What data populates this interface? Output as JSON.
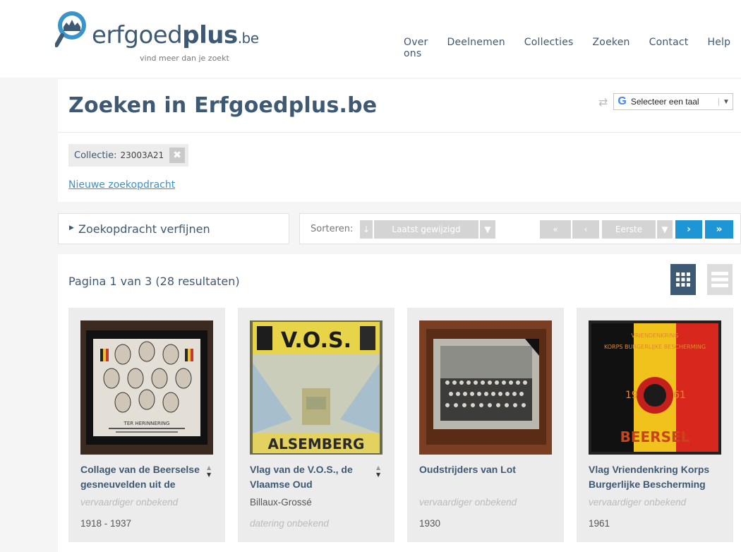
{
  "header": {
    "logo_name": "erfgoed",
    "logo_bold": "plus",
    "logo_tld": ".be",
    "tagline": "vind meer dan je zoekt",
    "nav": [
      "Over ons",
      "Deelnemen",
      "Collecties",
      "Zoeken",
      "Contact",
      "Help"
    ]
  },
  "page_title": "Zoeken in Erfgoedplus.be",
  "translate": {
    "label": "Selecteer een taal",
    "icon": "google-icon"
  },
  "filter": {
    "label": "Collectie:",
    "value": "23003A21"
  },
  "new_search": "Nieuwe zoekopdracht",
  "refine": "Zoekopdracht verfijnen",
  "sort": {
    "label": "Sorteren:",
    "selected": "Laatst gewijzigd"
  },
  "pager": {
    "first": "«",
    "prev": "‹",
    "position": "Eerste",
    "next": "›",
    "last": "»"
  },
  "results_summary": "Pagina 1 van 3 (28 resultaten)",
  "cards": [
    {
      "title": "Collage van de Beerselse gesneuvelden uit de",
      "maker": "vervaardiger onbekend",
      "date": "1918 - 1937"
    },
    {
      "title": "Vlag van de V.O.S., de Vlaamse Oud",
      "maker": "Billaux-Grossé",
      "date": "datering onbekend"
    },
    {
      "title": "Oudstrijders van Lot",
      "maker": "vervaardiger onbekend",
      "date": "1930"
    },
    {
      "title": "Vlag Vriendenkring Korps Burgerlijke Bescherming",
      "maker": "vervaardiger onbekend",
      "date": "1961"
    }
  ],
  "thumb_texts": {
    "card1": "TER HERINNERING",
    "card2_top": "V.O.S.",
    "card2_bottom": "ALSEMBERG",
    "card4_top": "VRIENDENKRING",
    "card4_arc": "KORPS BURGERLIJKE BESCHERMING",
    "card4_19": "19",
    "card4_61": "61",
    "card4_bottom": "BEERSEL"
  },
  "colors": {
    "brand": "#3e5973",
    "link": "#3a93c9",
    "accent": "#1e96d6"
  }
}
